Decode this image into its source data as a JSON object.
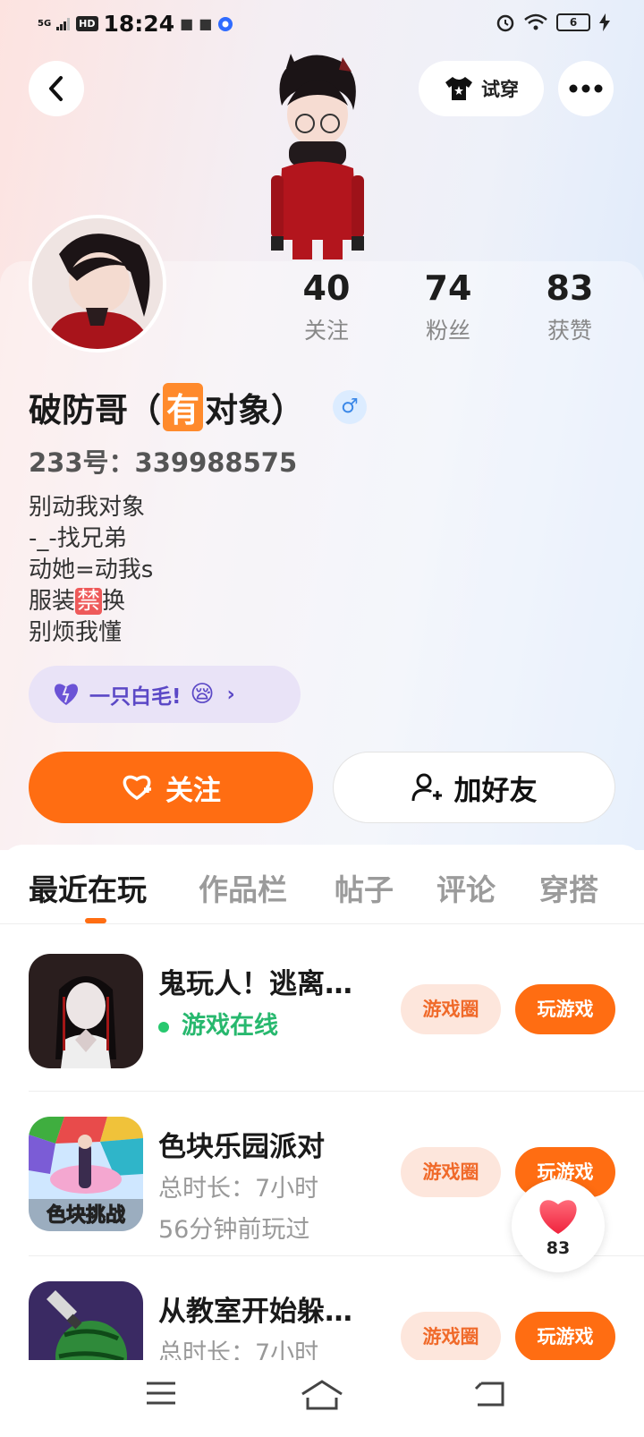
{
  "status_bar": {
    "signal": "5G",
    "hd": "HD",
    "time": "18:24",
    "battery": "6"
  },
  "header": {
    "tryon_label": "试穿"
  },
  "stats": [
    {
      "value": "40",
      "label": "关注"
    },
    {
      "value": "74",
      "label": "粉丝"
    },
    {
      "value": "83",
      "label": "获赞"
    }
  ],
  "profile": {
    "name_prefix": "破防哥（",
    "name_tag": "有",
    "name_suffix": "对象）",
    "gender_symbol": "♂",
    "uid": "233号：339988575",
    "bio": {
      "line1": "别动我对象",
      "line2": "-_-找兄弟",
      "line3": "动她=动我s",
      "line4_pre": "服装",
      "line4_tag": "禁",
      "line4_post": "换",
      "line5": "别烦我懂"
    },
    "badge_text": "一只白毛!",
    "badge_emoji": "😪"
  },
  "actions": {
    "follow_label": "关注",
    "add_friend_label": "加好友"
  },
  "tabs": [
    {
      "label": "最近在玩",
      "active": true
    },
    {
      "label": "作品栏",
      "active": false
    },
    {
      "label": "帖子",
      "active": false
    },
    {
      "label": "评论",
      "active": false
    },
    {
      "label": "穿搭",
      "active": false
    }
  ],
  "games": [
    {
      "title": "鬼玩人！逃离…",
      "sub1": "游戏在线",
      "sub2": "",
      "circle_label": "游戏圈",
      "play_label": "玩游戏"
    },
    {
      "title": "色块乐园派对",
      "sub1": "总时长：7小时",
      "sub2": "56分钟前玩过",
      "circle_label": "游戏圈",
      "play_label": "玩游戏",
      "icon_text": "色块挑战"
    },
    {
      "title": "从教室开始躲…",
      "sub1": "总时长：7小时",
      "sub2": "",
      "circle_label": "游戏圈",
      "play_label": "玩游戏"
    }
  ],
  "like_float": {
    "count": "83"
  },
  "colors": {
    "accent": "#ff6d12",
    "online": "#27b86e",
    "badge_bg": "#e9e3f7"
  }
}
